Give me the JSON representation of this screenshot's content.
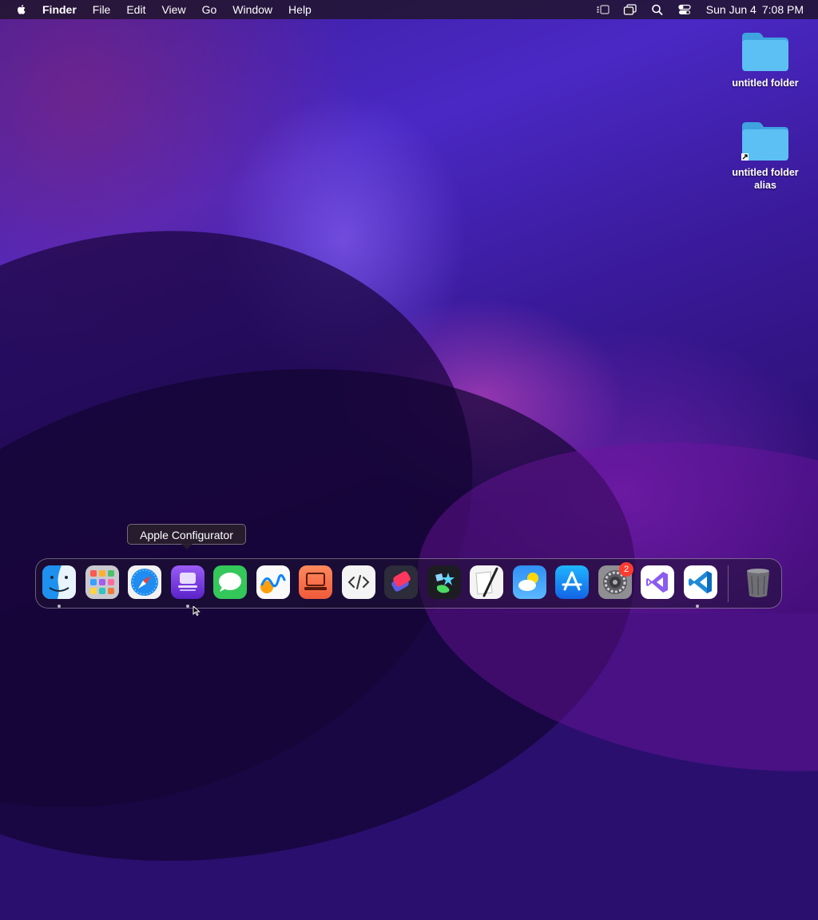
{
  "menubar": {
    "app_name": "Finder",
    "items": [
      "File",
      "Edit",
      "View",
      "Go",
      "Window",
      "Help"
    ],
    "status_icons": [
      "stage-manager-icon",
      "screen-mirroring-icon",
      "spotlight-search-icon",
      "control-center-icon"
    ],
    "date": "Sun Jun 4",
    "time": "7:08 PM"
  },
  "desktop": {
    "icons": [
      {
        "label": "untitled folder",
        "icon": "folder-icon"
      },
      {
        "label": "untitled folder alias",
        "icon": "folder-alias-icon"
      }
    ]
  },
  "tooltip": {
    "text": "Apple Configurator"
  },
  "dock": {
    "apps": [
      {
        "name": "finder",
        "icon": "finder-icon",
        "running": true
      },
      {
        "name": "launchpad",
        "icon": "launchpad-icon",
        "running": false
      },
      {
        "name": "safari",
        "icon": "safari-icon",
        "running": false
      },
      {
        "name": "apple-configurator",
        "icon": "apple-configurator-icon",
        "running": true
      },
      {
        "name": "messages",
        "icon": "messages-icon",
        "running": false
      },
      {
        "name": "freeform",
        "icon": "freeform-icon",
        "running": false
      },
      {
        "name": "screen-sharing",
        "icon": "screen-sharing-icon",
        "running": false
      },
      {
        "name": "script-editor",
        "icon": "code-editor-icon",
        "running": false
      },
      {
        "name": "shortcuts",
        "icon": "shortcuts-icon",
        "running": false
      },
      {
        "name": "reality-composer",
        "icon": "reality-composer-icon",
        "running": false
      },
      {
        "name": "script-editor-quill",
        "icon": "quill-icon",
        "running": false
      },
      {
        "name": "weather",
        "icon": "weather-icon",
        "running": false
      },
      {
        "name": "app-store",
        "icon": "app-store-icon",
        "running": false
      },
      {
        "name": "system-settings",
        "icon": "gear-icon",
        "running": false,
        "badge": "2"
      },
      {
        "name": "visual-studio",
        "icon": "visual-studio-icon",
        "running": false
      },
      {
        "name": "vscode",
        "icon": "vscode-icon",
        "running": true
      },
      {
        "name": "trash",
        "icon": "trash-icon",
        "running": false
      }
    ]
  }
}
